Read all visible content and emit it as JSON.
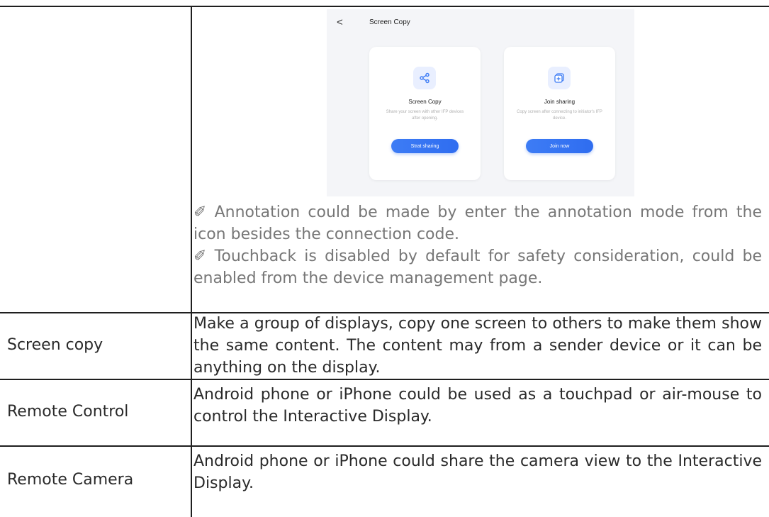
{
  "screenshot": {
    "back_glyph": "<",
    "title": "Screen Copy",
    "cards": [
      {
        "title": "Screen Copy",
        "desc": "Share your screen with other IFP devices after opening.",
        "button": "Strat sharing",
        "icon": "share-icon"
      },
      {
        "title": "Join sharing",
        "desc": "Copy screen after connecting to initiator's IFP device.",
        "button": "Join now",
        "icon": "join-screen-icon"
      }
    ],
    "accent_color": "#3d7cf5"
  },
  "notes": [
    {
      "icon": "pencil-icon",
      "glyph": "✐",
      "text": "Annotation could be made by enter the annotation mode from the icon besides the connection code."
    },
    {
      "icon": "pencil-icon",
      "glyph": "✐",
      "text": "Touchback is disabled by default for safety consideration, could be enabled from the device management page."
    }
  ],
  "rows": [
    {
      "feature": "Screen copy",
      "description": "Make a group of displays, copy one screen to others to make them show the same content. The content may from a sender device or it can be anything on the display."
    },
    {
      "feature": "Remote Control",
      "description": "Android phone or iPhone could be used as a touchpad or air-mouse to control the Interactive Display."
    },
    {
      "feature": "Remote Camera",
      "description": "Android phone or iPhone could share the camera view to the Interactive Display."
    }
  ]
}
